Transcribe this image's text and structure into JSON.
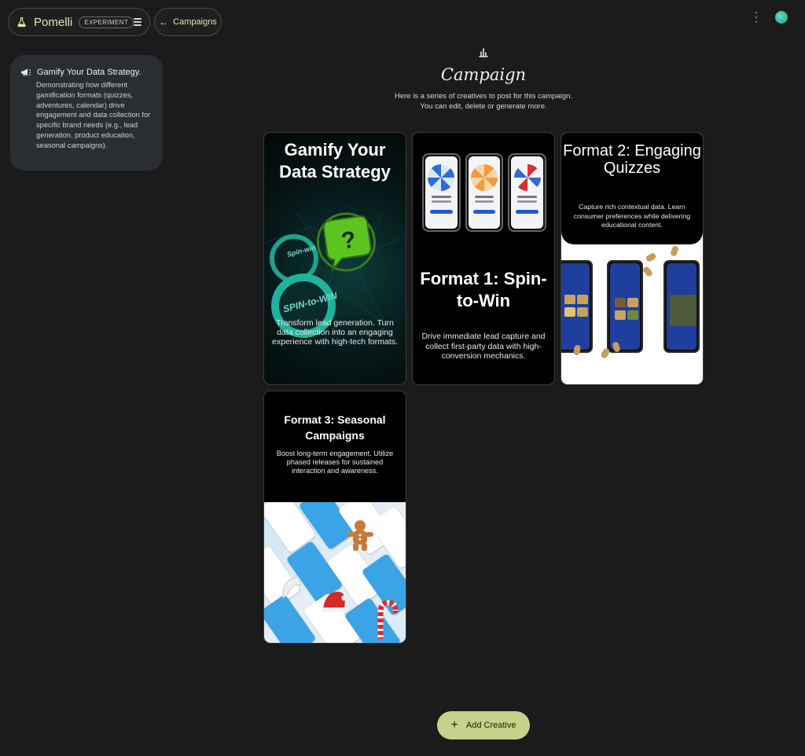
{
  "app": {
    "name": "Pomelli",
    "badge": "EXPERIMENT",
    "back_label": "Campaigns",
    "accent": "#dfe9b0"
  },
  "sidebar": {
    "title": "Gamify Your Data Strategy.",
    "description": "Demonstrating how different gamification formats (quizzes, adventures, calendar) drive engagement and data collection for specific brand needs (e.g., lead generation, product education, seasonal campaigns)."
  },
  "header": {
    "title": "Campaign",
    "subtitle_line1": "Here is a series of creatives to post for this campaign.",
    "subtitle_line2": "You can edit, delete or generate more."
  },
  "cards": [
    {
      "title": "Gamify Your Data Strategy",
      "art_text_1": "Spin-win",
      "art_text_2": "SPIN-to-WIN",
      "description": "Transform lead generation. Turn data collection into an engaging experience with high-tech formats."
    },
    {
      "title": "Format 1: Spin-to-Win",
      "description": "Drive immediate lead capture and collect first-party data with high-conversion mechanics."
    },
    {
      "title": "Format 2: Engaging Quizzes",
      "description": "Capture rich contextual data. Learn consumer preferences while delivering educational content."
    },
    {
      "title": "Format 3: Seasonal Campaigns",
      "description": "Boost long-term engagement. Utilize phased releases for sustained interaction and awareness."
    }
  ],
  "actions": {
    "add_creative": "Add Creative",
    "button_color": "#c5d28a"
  }
}
